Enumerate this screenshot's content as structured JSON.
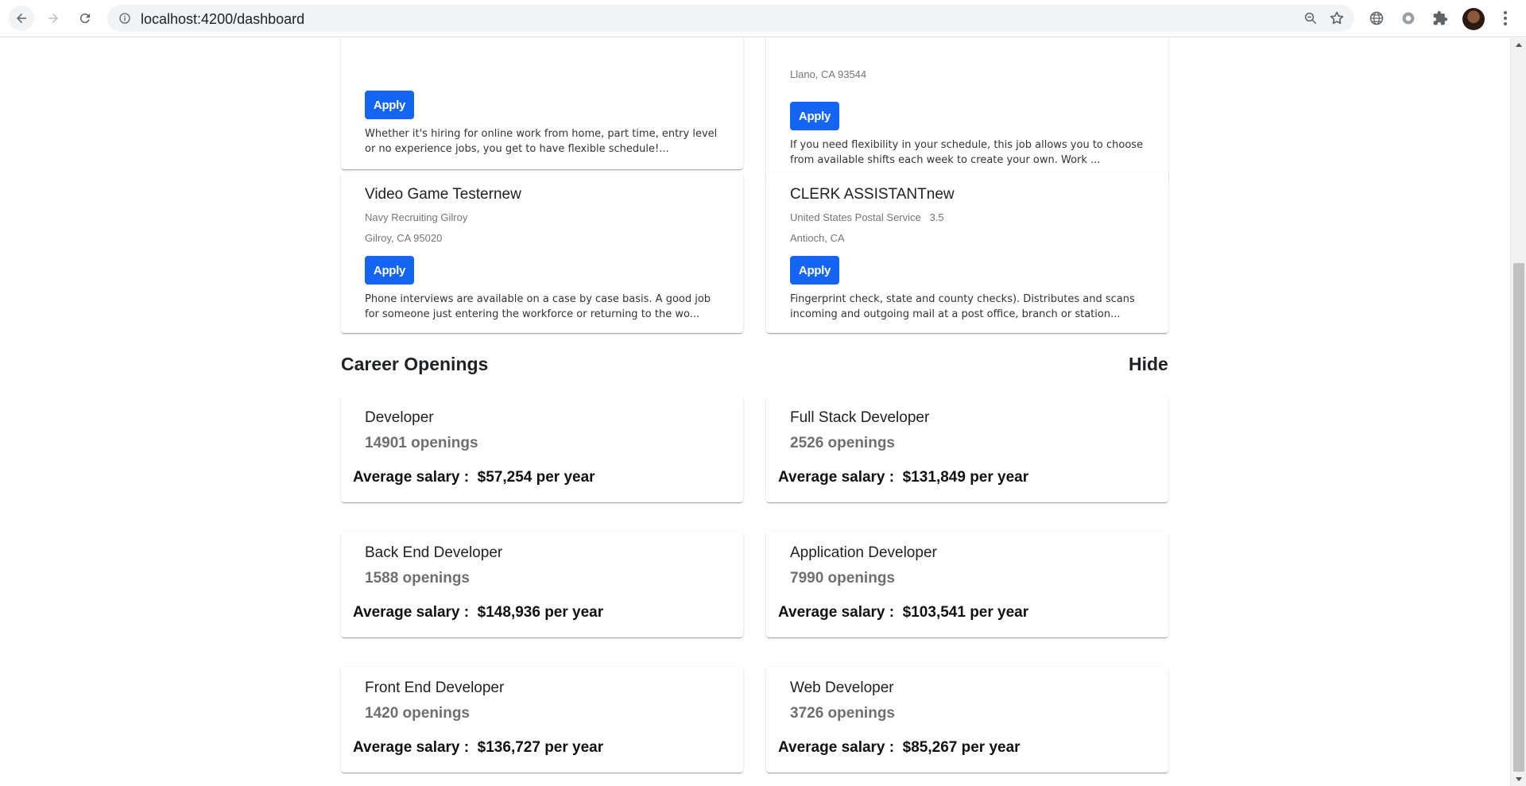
{
  "browser": {
    "url": "localhost:4200/dashboard"
  },
  "jobs": [
    {
      "title": "",
      "company": "",
      "location": "",
      "apply_label": "Apply",
      "description": "Whether it's hiring for online work from home, part time, entry level or no experience jobs, you get to have flexible schedule!..."
    },
    {
      "title": "",
      "company": "",
      "location": "Llano, CA 93544",
      "apply_label": "Apply",
      "description": "If you need flexibility in your schedule, this job allows you to choose from available shifts each week to create your own. Work ..."
    },
    {
      "title": "Video Game Testernew",
      "company": "Navy Recruiting Gilroy",
      "location": "Gilroy, CA 95020",
      "apply_label": "Apply",
      "description": "Phone interviews are available on a case by case basis. A good job for someone just entering the workforce or returning to the wo..."
    },
    {
      "title": "CLERK ASSISTANTnew",
      "company": "United States Postal Service",
      "rating": "3.5",
      "location": "Antioch, CA",
      "apply_label": "Apply",
      "description": "Fingerprint check, state and county checks). Distributes and scans incoming and outgoing mail at a post office, branch or station..."
    }
  ],
  "careers": {
    "title": "Career Openings",
    "hide_label": "Hide",
    "salary_prefix": "Average salary :  ",
    "items": [
      {
        "role": "Developer",
        "openings": "14901 openings",
        "salary": "$57,254 per year"
      },
      {
        "role": "Full Stack Developer",
        "openings": "2526 openings",
        "salary": "$131,849 per year"
      },
      {
        "role": "Back End Developer",
        "openings": "1588 openings",
        "salary": "$148,936 per year"
      },
      {
        "role": "Application Developer",
        "openings": "7990 openings",
        "salary": "$103,541 per year"
      },
      {
        "role": "Front End Developer",
        "openings": "1420 openings",
        "salary": "$136,727 per year"
      },
      {
        "role": "Web Developer",
        "openings": "3726 openings",
        "salary": "$85,267 per year"
      }
    ]
  }
}
